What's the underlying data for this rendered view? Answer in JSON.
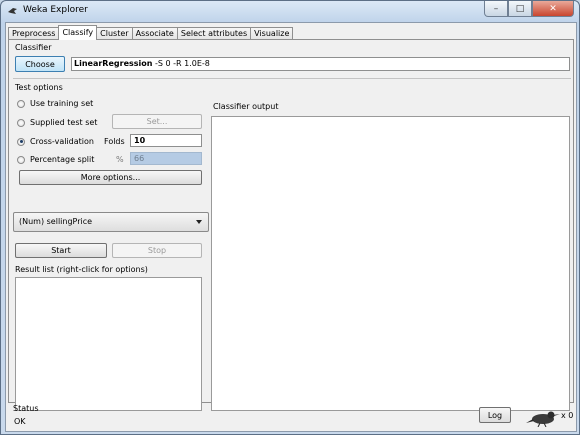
{
  "window": {
    "title": "Weka Explorer"
  },
  "tabs": [
    "Preprocess",
    "Classify",
    "Cluster",
    "Associate",
    "Select attributes",
    "Visualize"
  ],
  "classifier": {
    "group_label": "Classifier",
    "choose_label": "Choose",
    "name": "LinearRegression",
    "options": "-S 0 -R 1.0E-8"
  },
  "test_options": {
    "group_label": "Test options",
    "use_training_set": "Use training set",
    "supplied_test_set": "Supplied test set",
    "set_button": "Set...",
    "cross_validation": "Cross-validation",
    "folds_label": "Folds",
    "folds_value": "10",
    "percentage_split": "Percentage split",
    "percent_label": "%",
    "percent_value": "66",
    "more_options": "More options...",
    "selected": "cross_validation"
  },
  "class_attribute": "(Num) sellingPrice",
  "start_label": "Start",
  "stop_label": "Stop",
  "result_list_label": "Result list (right-click for options)",
  "output_label": "Classifier output",
  "status": {
    "group_label": "Status",
    "text": "OK",
    "log_label": "Log",
    "x_count": "x 0"
  }
}
